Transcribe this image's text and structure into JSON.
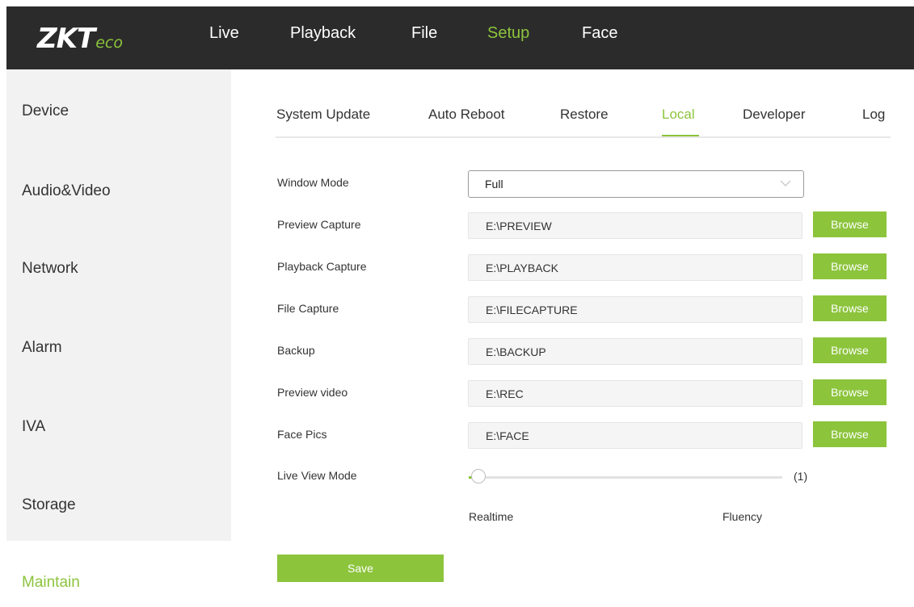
{
  "brand": {
    "logo_main": "ZKT",
    "logo_sub": "eco"
  },
  "nav": [
    {
      "label": "Live",
      "active": false
    },
    {
      "label": "Playback",
      "active": false
    },
    {
      "label": "File",
      "active": false
    },
    {
      "label": "Setup",
      "active": true
    },
    {
      "label": "Face",
      "active": false
    }
  ],
  "sidebar": [
    {
      "label": "Device",
      "active": false
    },
    {
      "label": "Audio&Video",
      "active": false
    },
    {
      "label": "Network",
      "active": false
    },
    {
      "label": "Alarm",
      "active": false
    },
    {
      "label": "IVA",
      "active": false
    },
    {
      "label": "Storage",
      "active": false
    },
    {
      "label": "Maintain",
      "active": true
    }
  ],
  "tabs": [
    {
      "label": "System Update",
      "active": false
    },
    {
      "label": "Auto Reboot",
      "active": false
    },
    {
      "label": "Restore",
      "active": false
    },
    {
      "label": "Local",
      "active": true
    },
    {
      "label": "Developer",
      "active": false
    },
    {
      "label": "Log",
      "active": false
    }
  ],
  "form": {
    "window_mode": {
      "label": "Window Mode",
      "value": "Full"
    },
    "paths": [
      {
        "label": "Preview Capture",
        "value": "E:\\PREVIEW",
        "button": "Browse"
      },
      {
        "label": "Playback Capture",
        "value": "E:\\PLAYBACK",
        "button": "Browse"
      },
      {
        "label": "File Capture",
        "value": "E:\\FILECAPTURE",
        "button": "Browse"
      },
      {
        "label": "Backup",
        "value": "E:\\BACKUP",
        "button": "Browse"
      },
      {
        "label": "Preview video",
        "value": "E:\\REC",
        "button": "Browse"
      },
      {
        "label": "Face Pics",
        "value": "E:\\FACE",
        "button": "Browse"
      }
    ],
    "live_view_mode": {
      "label": "Live View Mode",
      "value_text": "(1)",
      "min_label": "Realtime",
      "max_label": "Fluency"
    },
    "save_label": "Save"
  },
  "colors": {
    "accent": "#8cc43c",
    "topbar": "#2b2b2b",
    "sidebar": "#f2f2f2"
  }
}
